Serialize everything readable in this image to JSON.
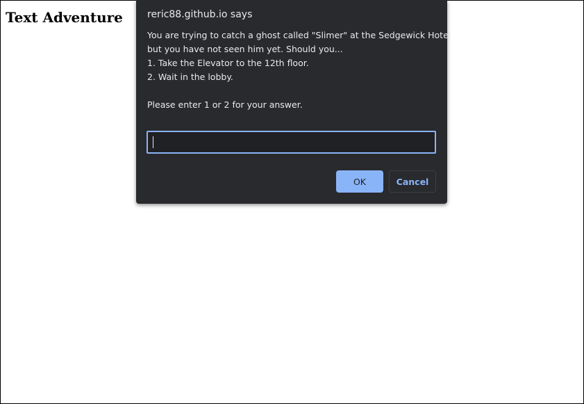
{
  "page": {
    "heading": "Text Adventure"
  },
  "dialog": {
    "title": "reric88.github.io says",
    "message_lines": [
      "You are trying to catch a ghost called \"Slimer\" at the Sedgewick Hotel",
      "but you have not seen him yet. Should you...",
      "1. Take the Elevator to the 12th floor.",
      "2. Wait in the lobby.",
      "",
      "Please enter 1 or 2 for your answer."
    ],
    "input_value": "",
    "ok_label": "OK",
    "cancel_label": "Cancel"
  },
  "colors": {
    "dialog_background": "#292a2d",
    "input_background": "#202124",
    "accent": "#8ab4f8",
    "text": "#e8eaed"
  }
}
